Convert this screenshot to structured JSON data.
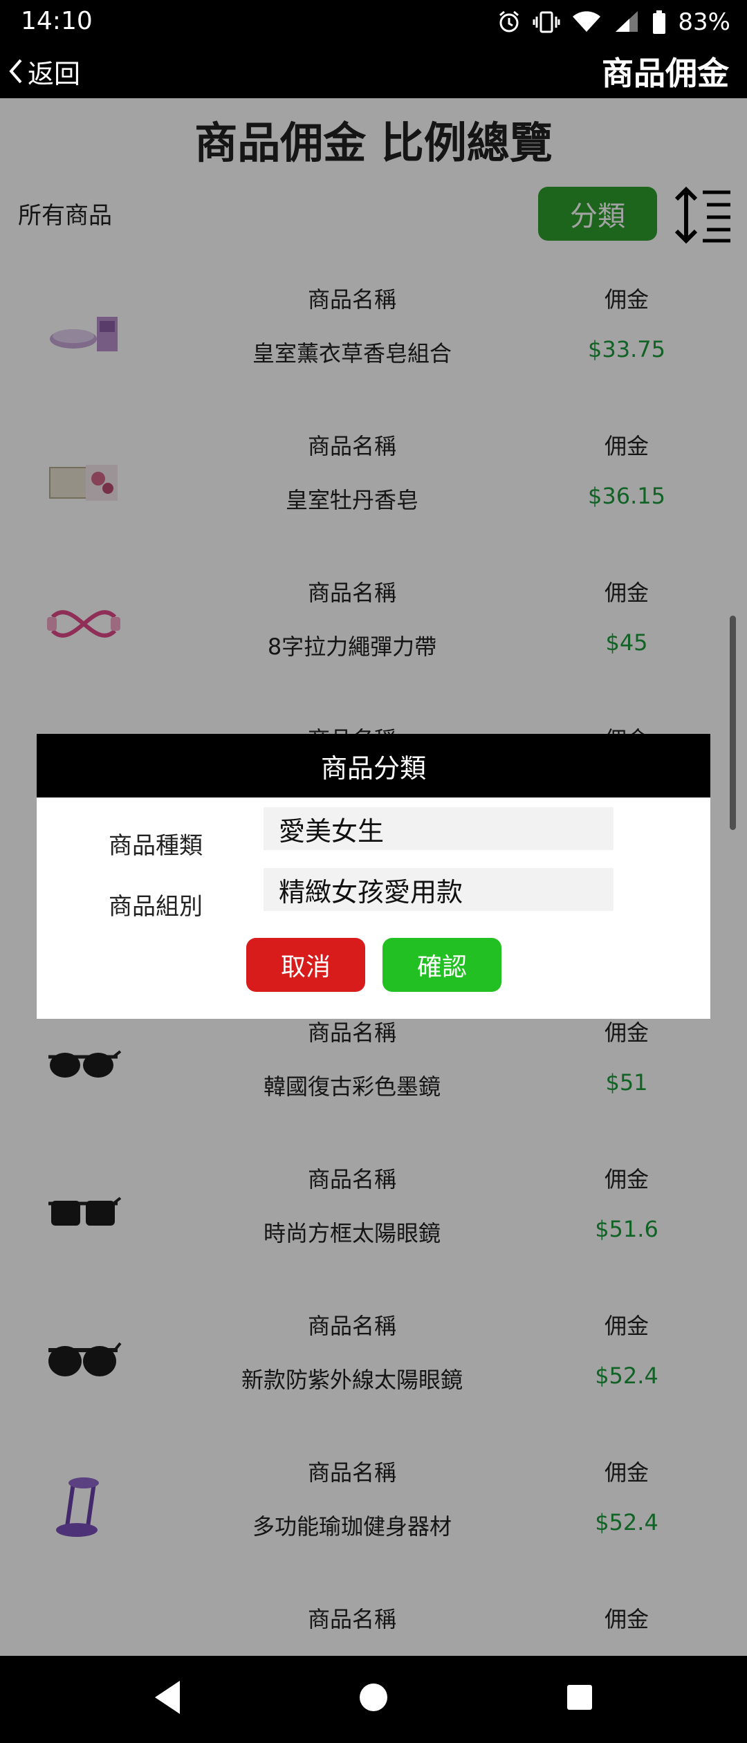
{
  "status_bar": {
    "time": "14:10",
    "battery": "83%"
  },
  "app_bar": {
    "back_label": "返回",
    "title": "商品佣金"
  },
  "page": {
    "title": "商品佣金 比例總覽",
    "filter_label": "所有商品",
    "category_button": "分類"
  },
  "list": {
    "header_name": "商品名稱",
    "header_commission": "佣金",
    "items": [
      {
        "name": "皇室薰衣草香皂組合",
        "commission": "$33.75",
        "thumb_icon": "lavender-soap-set"
      },
      {
        "name": "皇室牡丹香皂",
        "commission": "$36.15",
        "thumb_icon": "peony-soap"
      },
      {
        "name": "8字拉力繩彈力帶",
        "commission": "$45",
        "thumb_icon": "resistance-band"
      },
      {
        "name": "",
        "commission": "",
        "thumb_icon": ""
      },
      {
        "name": "",
        "commission": "",
        "thumb_icon": ""
      },
      {
        "name": "韓國復古彩色墨鏡",
        "commission": "$51",
        "thumb_icon": "sunglasses"
      },
      {
        "name": "時尚方框太陽眼鏡",
        "commission": "$51.6",
        "thumb_icon": "sunglasses"
      },
      {
        "name": "新款防紫外線太陽眼鏡",
        "commission": "$52.4",
        "thumb_icon": "sunglasses"
      },
      {
        "name": "多功能瑜珈健身器材",
        "commission": "$52.4",
        "thumb_icon": "yoga-pedal-puller"
      },
      {
        "name": "",
        "commission": "",
        "thumb_icon": "sunglasses"
      }
    ]
  },
  "dialog": {
    "title": "商品分類",
    "category_label": "商品種類",
    "category_value": "愛美女生",
    "group_label": "商品組別",
    "group_value": "精緻女孩愛用款",
    "cancel_label": "取消",
    "confirm_label": "確認"
  },
  "colors": {
    "accent_green": "#2e9e2e",
    "commission_green": "#1a9a3a",
    "cancel_red": "#d81b1b",
    "confirm_green": "#22c022"
  }
}
